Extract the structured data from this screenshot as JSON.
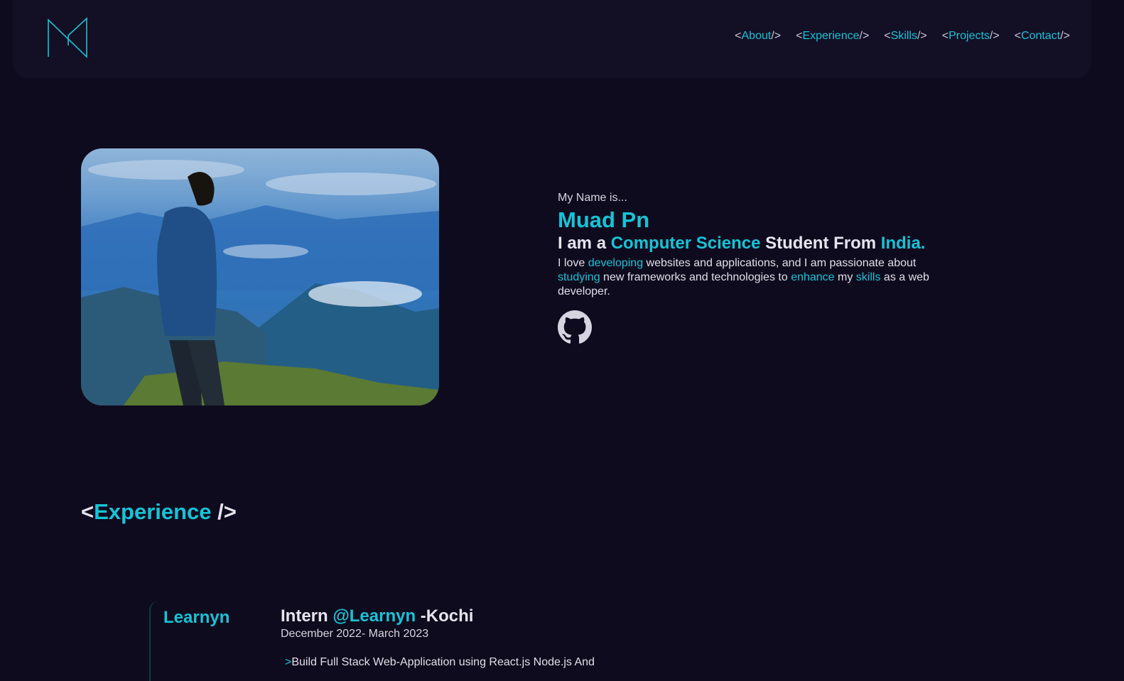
{
  "nav": {
    "items": [
      {
        "open": "<",
        "label": "About",
        "close": "/>"
      },
      {
        "open": "<",
        "label": "Experience",
        "close": "/>"
      },
      {
        "open": "<",
        "label": "Skills",
        "close": "/>"
      },
      {
        "open": "<",
        "label": "Projects",
        "close": "/>"
      },
      {
        "open": "<",
        "label": "Contact",
        "close": "/>"
      }
    ]
  },
  "hero": {
    "greeting": "My Name is...",
    "name": "Muad Pn",
    "tagline": {
      "part1": "I am a ",
      "highlight1": "Computer Science",
      "part2": " Student From ",
      "highlight2": "India."
    },
    "description": {
      "t1": "I love ",
      "h1": "developing",
      "t2": " websites and applications, and I am passionate about ",
      "h2": "studying",
      "t3": " new frameworks and technologies to ",
      "h3": "enhance",
      "t4": " my ",
      "h4": "skills",
      "t5": " as a web developer."
    },
    "social": {
      "icon": "github-icon"
    }
  },
  "experience": {
    "title_open": "<",
    "title": "Experience",
    "title_close": " />",
    "company_tab": "Learnyn",
    "role": "Intern ",
    "company": "@Learnyn",
    "location": " -Kochi",
    "dates": "December 2022- March 2023",
    "bullet": ">",
    "point": "Build Full Stack Web-Application using React.js Node.js And"
  },
  "colors": {
    "background": "#0f0b1e",
    "header": "#130f25",
    "accent": "#17c3d6",
    "text": "#d6d4e0"
  }
}
